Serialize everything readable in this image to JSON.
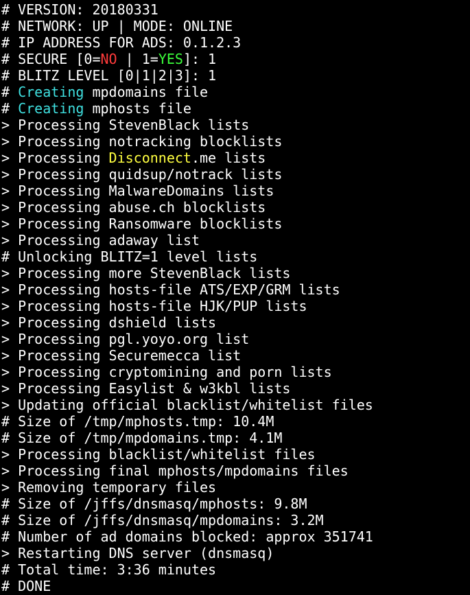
{
  "colors": {
    "background": "#000000",
    "default": "#ffffff",
    "cyan": "#3fe0e0",
    "red": "#ff3b3b",
    "green": "#3bff3b",
    "yellow": "#ffff40"
  },
  "lines": [
    [
      {
        "t": "# VERSION: 20180331"
      }
    ],
    [
      {
        "t": "# NETWORK: UP | MODE: ONLINE"
      }
    ],
    [
      {
        "t": "# IP ADDRESS FOR ADS: 0.1.2.3"
      }
    ],
    [
      {
        "t": "# SECURE [0="
      },
      {
        "t": "NO",
        "c": "red"
      },
      {
        "t": " | 1="
      },
      {
        "t": "YES",
        "c": "green"
      },
      {
        "t": "]: 1"
      }
    ],
    [
      {
        "t": "# BLITZ LEVEL [0|1|2|3]: 1"
      }
    ],
    [
      {
        "t": "# "
      },
      {
        "t": "Creating",
        "c": "cyan"
      },
      {
        "t": " mpdomains file"
      }
    ],
    [
      {
        "t": "# "
      },
      {
        "t": "Creating",
        "c": "cyan"
      },
      {
        "t": " mphosts file"
      }
    ],
    [
      {
        "t": "> Processing StevenBlack lists"
      }
    ],
    [
      {
        "t": "> Processing notracking blocklists"
      }
    ],
    [
      {
        "t": "> Processing "
      },
      {
        "t": "Disconnect",
        "c": "yellow"
      },
      {
        "t": ".me lists"
      }
    ],
    [
      {
        "t": "> Processing quidsup/notrack lists"
      }
    ],
    [
      {
        "t": "> Processing MalwareDomains lists"
      }
    ],
    [
      {
        "t": "> Processing abuse.ch blocklists"
      }
    ],
    [
      {
        "t": "> Processing Ransomware blocklists"
      }
    ],
    [
      {
        "t": "> Processing adaway list"
      }
    ],
    [
      {
        "t": "# Unlocking BLITZ=1 level lists"
      }
    ],
    [
      {
        "t": "> Processing more StevenBlack lists"
      }
    ],
    [
      {
        "t": "> Processing hosts-file ATS/EXP/GRM lists"
      }
    ],
    [
      {
        "t": "> Processing hosts-file HJK/PUP lists"
      }
    ],
    [
      {
        "t": "> Processing dshield lists"
      }
    ],
    [
      {
        "t": "> Processing pgl.yoyo.org list"
      }
    ],
    [
      {
        "t": "> Processing Securemecca list"
      }
    ],
    [
      {
        "t": "> Processing cryptomining and porn lists"
      }
    ],
    [
      {
        "t": "> Processing Easylist & w3kbl lists"
      }
    ],
    [
      {
        "t": "> Updating official blacklist/whitelist files"
      }
    ],
    [
      {
        "t": "# Size of /tmp/mphosts.tmp: 10.4M"
      }
    ],
    [
      {
        "t": "# Size of /tmp/mpdomains.tmp: 4.1M"
      }
    ],
    [
      {
        "t": "> Processing blacklist/whitelist files"
      }
    ],
    [
      {
        "t": "> Processing final mphosts/mpdomains files"
      }
    ],
    [
      {
        "t": "> Removing temporary files"
      }
    ],
    [
      {
        "t": "# Size of /jffs/dnsmasq/mphosts: 9.8M"
      }
    ],
    [
      {
        "t": "# Size of /jffs/dnsmasq/mpdomains: 3.2M"
      }
    ],
    [
      {
        "t": "# Number of ad domains blocked: approx 351741"
      }
    ],
    [
      {
        "t": "> Restarting DNS server (dnsmasq)"
      }
    ],
    [
      {
        "t": "# Total time: 3:36 minutes"
      }
    ],
    [
      {
        "t": "# DONE"
      }
    ]
  ]
}
